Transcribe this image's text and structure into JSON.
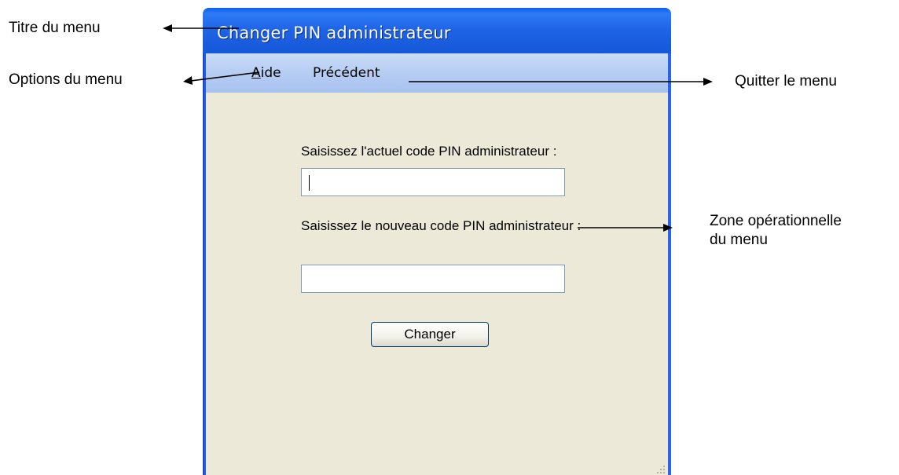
{
  "annotations": {
    "title_label": "Titre du menu",
    "options_label": "Options du menu",
    "exit_label": "Quitter le menu",
    "zone_label_line1": "Zone opérationnelle",
    "zone_label_line2": "du menu"
  },
  "window": {
    "title": "Changer PIN administrateur",
    "menu": {
      "help": "Aide",
      "help_accel": "A",
      "help_rest": "ide",
      "back": "Précédent"
    }
  },
  "form": {
    "current_pin_label": "Saisissez l'actuel code PIN administrateur :",
    "current_pin_value": "",
    "new_pin_label": "Saisissez le nouveau code PIN administrateur :",
    "new_pin_value": "",
    "change_button": "Changer"
  },
  "colors": {
    "titlebar": "#1e63e6",
    "menubar": "#b6cdf3",
    "client": "#ece9d8",
    "input_border": "#7f9db9"
  }
}
